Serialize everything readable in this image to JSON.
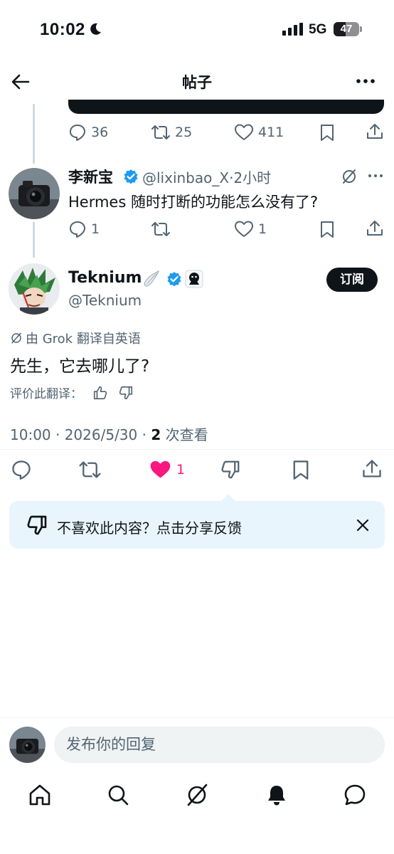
{
  "status_bar": {
    "time": "10:02",
    "network": "5G",
    "battery": "47",
    "battery_level": 0.47
  },
  "header": {
    "title": "帖子"
  },
  "prev_tweet_actions": {
    "replies": "36",
    "retweets": "25",
    "likes": "411"
  },
  "reply_tweet": {
    "name": "李新宝",
    "handle_time": "@lixinbao_X·2小时",
    "text": "Hermes 随时打断的功能怎么没有了?",
    "replies": "1",
    "likes": "1"
  },
  "main_tweet": {
    "name": "Teknium",
    "handle": "@Teknium",
    "subscribe_label": "订阅",
    "translated_note": "由 Grok 翻译自英语",
    "text": "先生，它去哪儿了?",
    "rate_label": "评价此翻译：",
    "meta_prefix": "10:00 · 2026/5/30 · ",
    "views": "2",
    "views_label": " 次查看",
    "likes": "1"
  },
  "feedback": {
    "text": "不喜欢此内容？点击分享反馈"
  },
  "composer": {
    "placeholder": "发布你的回复"
  },
  "colors": {
    "accent": "#1d9bf0",
    "like": "#f91880",
    "text": "#0f1419",
    "muted": "#536471"
  },
  "icons": [
    "back-arrow-icon",
    "more-icon",
    "reply-icon",
    "retweet-icon",
    "like-icon",
    "bookmark-icon",
    "share-icon",
    "grok-icon",
    "thumbs-up-icon",
    "thumbs-down-icon",
    "close-icon",
    "home-icon",
    "search-icon",
    "bell-icon",
    "messages-icon",
    "verified-icon",
    "wing-emoji-icon"
  ]
}
